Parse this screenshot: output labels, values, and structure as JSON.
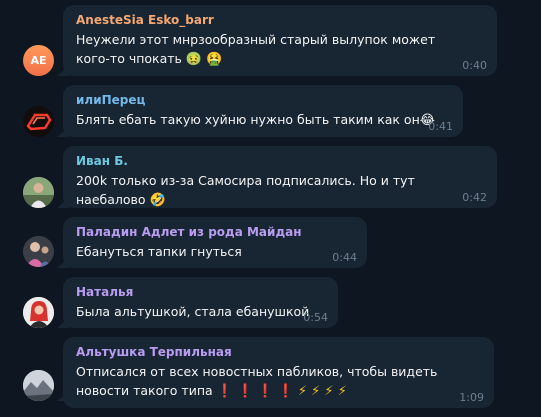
{
  "messages": [
    {
      "author": "AnesteSia Esko_barr",
      "author_color": "#f5a872",
      "avatar_initials": "AE",
      "text": "Неужели этот мнрзообразный старый вылупок может кого-то чпокать",
      "emojis": "🤢 🤮",
      "time": "0:40"
    },
    {
      "author": "илиПерец",
      "author_color": "#74b9ea",
      "text": "Блять ебать такую хуйню нужно быть таким как он",
      "emojis": "😂",
      "time": "0:41"
    },
    {
      "author": "Иван Б.",
      "author_color": "#6ec8e0",
      "text": "200k только из-за Самосира подписались. Но и тут наебалово",
      "emojis": "🤣",
      "time": "0:42"
    },
    {
      "author": "Паладин Адлет из рода Майдан",
      "author_color": "#b99df0",
      "text": "Ебануться тапки гнуться",
      "time": "0:44"
    },
    {
      "author": "Наталья",
      "author_color": "#b99df0",
      "text": "Была альтушкой, стала ебанушкой",
      "time": "0:54"
    },
    {
      "author": "Альтушка Терпильная",
      "author_color": "#b99df0",
      "text": "Отписался от всех новостных пабликов, чтобы видеть новости такого типа",
      "emojis": "❗ ❗ ❗ ❗ ⚡ ⚡ ⚡ ⚡",
      "time": "1:09"
    }
  ]
}
